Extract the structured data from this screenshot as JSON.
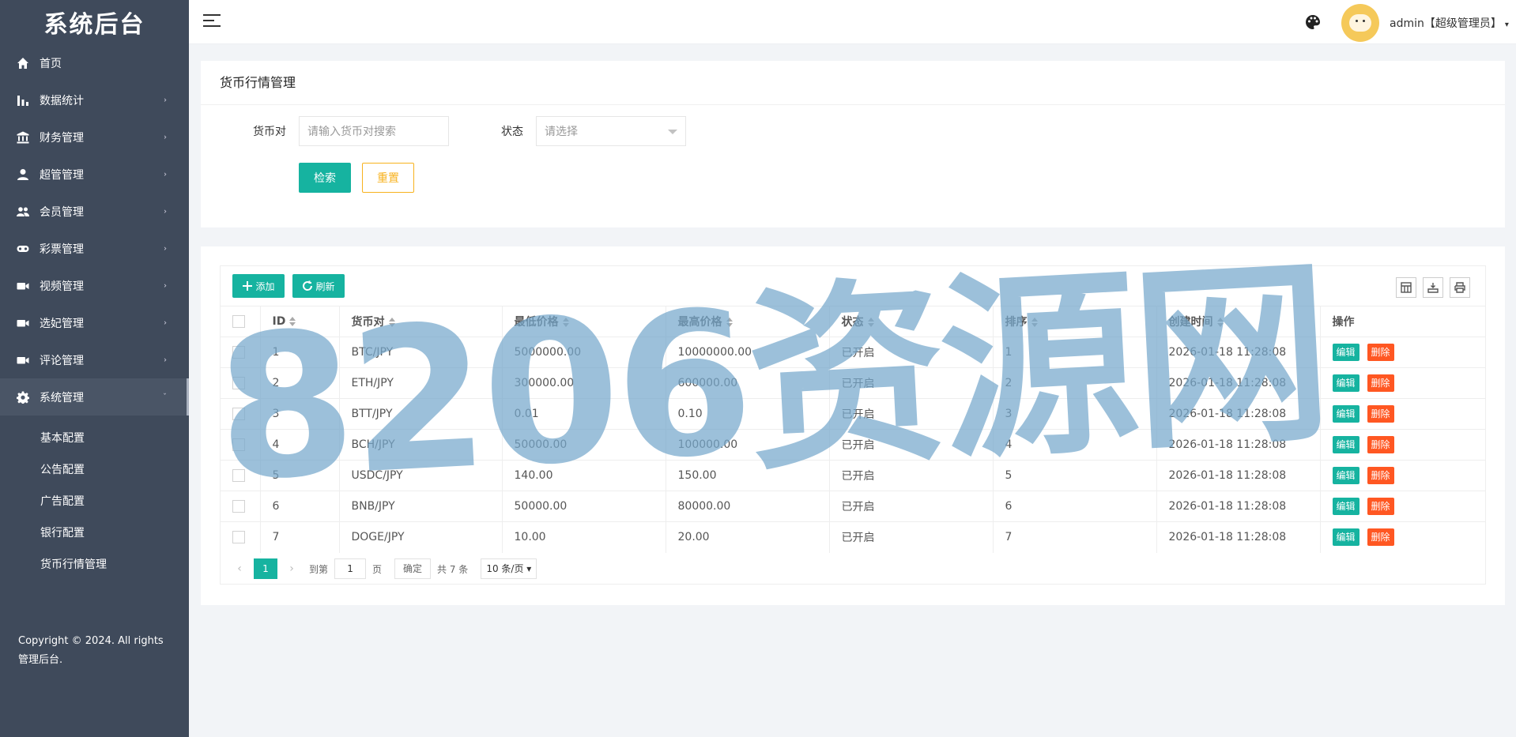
{
  "sidebar": {
    "brand": "系统后台",
    "items": [
      {
        "label": "首页",
        "icon": "home-icon",
        "arrow": ""
      },
      {
        "label": "数据统计",
        "icon": "bar-chart-icon",
        "arrow": "›"
      },
      {
        "label": "财务管理",
        "icon": "bank-icon",
        "arrow": "›"
      },
      {
        "label": "超管管理",
        "icon": "user-icon",
        "arrow": "›"
      },
      {
        "label": "会员管理",
        "icon": "group-icon",
        "arrow": "›"
      },
      {
        "label": "彩票管理",
        "icon": "gamepad-icon",
        "arrow": "›"
      },
      {
        "label": "视频管理",
        "icon": "video-icon",
        "arrow": "›"
      },
      {
        "label": "选妃管理",
        "icon": "video-icon",
        "arrow": "›"
      },
      {
        "label": "评论管理",
        "icon": "video-icon",
        "arrow": "›"
      },
      {
        "label": "系统管理",
        "icon": "gear-icon",
        "arrow": "ˇ"
      }
    ],
    "submenu": [
      "基本配置",
      "公告配置",
      "广告配置",
      "银行配置",
      "货币行情管理"
    ],
    "copyright": "Copyright © 2024. All rights 管理后台."
  },
  "header": {
    "user": "admin【超级管理员】",
    "caret": "▾"
  },
  "search": {
    "title": "货币行情管理",
    "pair_label": "货币对",
    "pair_placeholder": "请输入货币对搜索",
    "status_label": "状态",
    "status_placeholder": "请选择",
    "search_button": "检索",
    "reset_button": "重置"
  },
  "toolbar": {
    "add_label": "添加",
    "refresh_label": "刷新"
  },
  "table": {
    "columns": [
      "ID",
      "货币对",
      "最低价格",
      "最高价格",
      "状态",
      "排序",
      "创建时间",
      "操作"
    ],
    "edit_label": "编辑",
    "delete_label": "删除",
    "rows": [
      {
        "id": "1",
        "pair": "BTC/JPY",
        "low": "5000000.00",
        "high": "10000000.00",
        "status": "已开启",
        "sort": "1",
        "created": "2026-01-18 11:28:08"
      },
      {
        "id": "2",
        "pair": "ETH/JPY",
        "low": "300000.00",
        "high": "600000.00",
        "status": "已开启",
        "sort": "2",
        "created": "2026-01-18 11:28:08"
      },
      {
        "id": "3",
        "pair": "BTT/JPY",
        "low": "0.01",
        "high": "0.10",
        "status": "已开启",
        "sort": "3",
        "created": "2026-01-18 11:28:08"
      },
      {
        "id": "4",
        "pair": "BCH/JPY",
        "low": "50000.00",
        "high": "100000.00",
        "status": "已开启",
        "sort": "4",
        "created": "2026-01-18 11:28:08"
      },
      {
        "id": "5",
        "pair": "USDC/JPY",
        "low": "140.00",
        "high": "150.00",
        "status": "已开启",
        "sort": "5",
        "created": "2026-01-18 11:28:08"
      },
      {
        "id": "6",
        "pair": "BNB/JPY",
        "low": "50000.00",
        "high": "80000.00",
        "status": "已开启",
        "sort": "6",
        "created": "2026-01-18 11:28:08"
      },
      {
        "id": "7",
        "pair": "DOGE/JPY",
        "low": "10.00",
        "high": "20.00",
        "status": "已开启",
        "sort": "7",
        "created": "2026-01-18 11:28:08"
      }
    ]
  },
  "pager": {
    "current": "1",
    "goto_prefix": "到第",
    "goto_value": "1",
    "goto_suffix": "页",
    "confirm": "确定",
    "total": "共 7 条",
    "page_size": "10 条/页"
  },
  "watermark": "8206资源网"
}
